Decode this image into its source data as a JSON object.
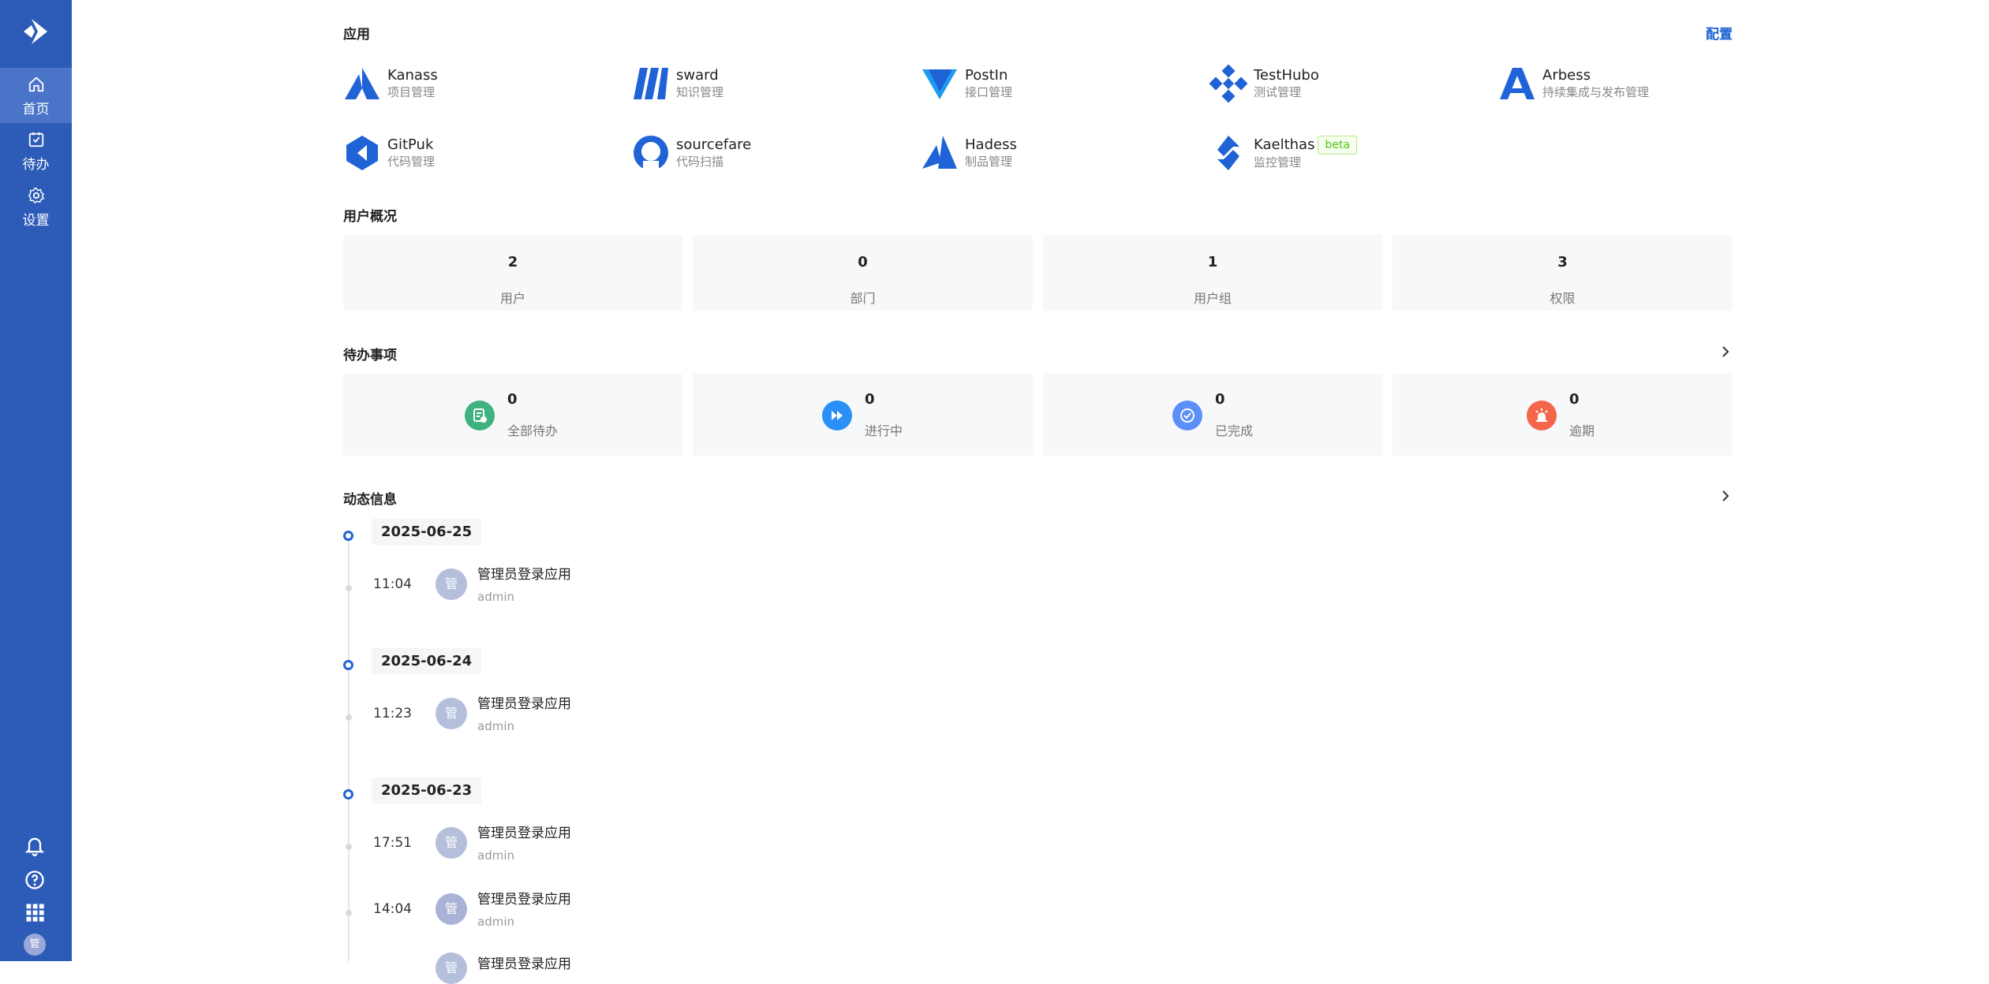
{
  "sidebar": {
    "items": [
      {
        "label": "首页",
        "icon": "home-icon",
        "active": true
      },
      {
        "label": "待办",
        "icon": "todo-icon",
        "active": false
      },
      {
        "label": "设置",
        "icon": "gear-icon",
        "active": false
      }
    ],
    "bottom_icons": [
      "bell-icon",
      "help-icon",
      "apps-grid-icon"
    ],
    "avatar_text": "管"
  },
  "apps_section": {
    "title": "应用",
    "config_label": "配置",
    "apps": [
      {
        "name": "Kanass",
        "sub": "项目管理",
        "icon": "kanass-logo-icon"
      },
      {
        "name": "sward",
        "sub": "知识管理",
        "icon": "sward-logo-icon"
      },
      {
        "name": "PostIn",
        "sub": "接口管理",
        "icon": "postin-logo-icon"
      },
      {
        "name": "TestHubo",
        "sub": "测试管理",
        "icon": "testhubo-logo-icon"
      },
      {
        "name": "Arbess",
        "sub": "持续集成与发布管理",
        "icon": "arbess-logo-icon"
      },
      {
        "name": "GitPuk",
        "sub": "代码管理",
        "icon": "gitpuk-logo-icon"
      },
      {
        "name": "sourcefare",
        "sub": "代码扫描",
        "icon": "sourcefare-logo-icon"
      },
      {
        "name": "Hadess",
        "sub": "制品管理",
        "icon": "hadess-logo-icon"
      },
      {
        "name": "Kaelthas",
        "sub": "监控管理",
        "icon": "kaelthas-logo-icon",
        "badge": "beta"
      }
    ]
  },
  "user_overview": {
    "title": "用户概况",
    "stats": [
      {
        "value": "2",
        "label": "用户"
      },
      {
        "value": "0",
        "label": "部门"
      },
      {
        "value": "1",
        "label": "用户组"
      },
      {
        "value": "3",
        "label": "权限"
      }
    ]
  },
  "todos": {
    "title": "待办事项",
    "items": [
      {
        "value": "0",
        "label": "全部待办",
        "color": "#3fb27f",
        "icon": "list-icon"
      },
      {
        "value": "0",
        "label": "进行中",
        "color": "#2a8ff7",
        "icon": "fast-forward-icon"
      },
      {
        "value": "0",
        "label": "已完成",
        "color": "#5b8ff9",
        "icon": "check-icon"
      },
      {
        "value": "0",
        "label": "逾期",
        "color": "#f4664a",
        "icon": "alarm-icon"
      }
    ]
  },
  "activity": {
    "title": "动态信息",
    "groups": [
      {
        "date": "2025-06-25",
        "events": [
          {
            "time": "11:04",
            "title": "管理员登录应用",
            "user": "admin",
            "avatar": "管"
          }
        ]
      },
      {
        "date": "2025-06-24",
        "events": [
          {
            "time": "11:23",
            "title": "管理员登录应用",
            "user": "admin",
            "avatar": "管"
          }
        ]
      },
      {
        "date": "2025-06-23",
        "events": [
          {
            "time": "17:51",
            "title": "管理员登录应用",
            "user": "admin",
            "avatar": "管"
          },
          {
            "time": "14:04",
            "title": "管理员登录应用",
            "user": "admin",
            "avatar": "管"
          },
          {
            "time": "",
            "title": "管理员登录应用",
            "user": "",
            "avatar": "管"
          }
        ]
      }
    ]
  }
}
